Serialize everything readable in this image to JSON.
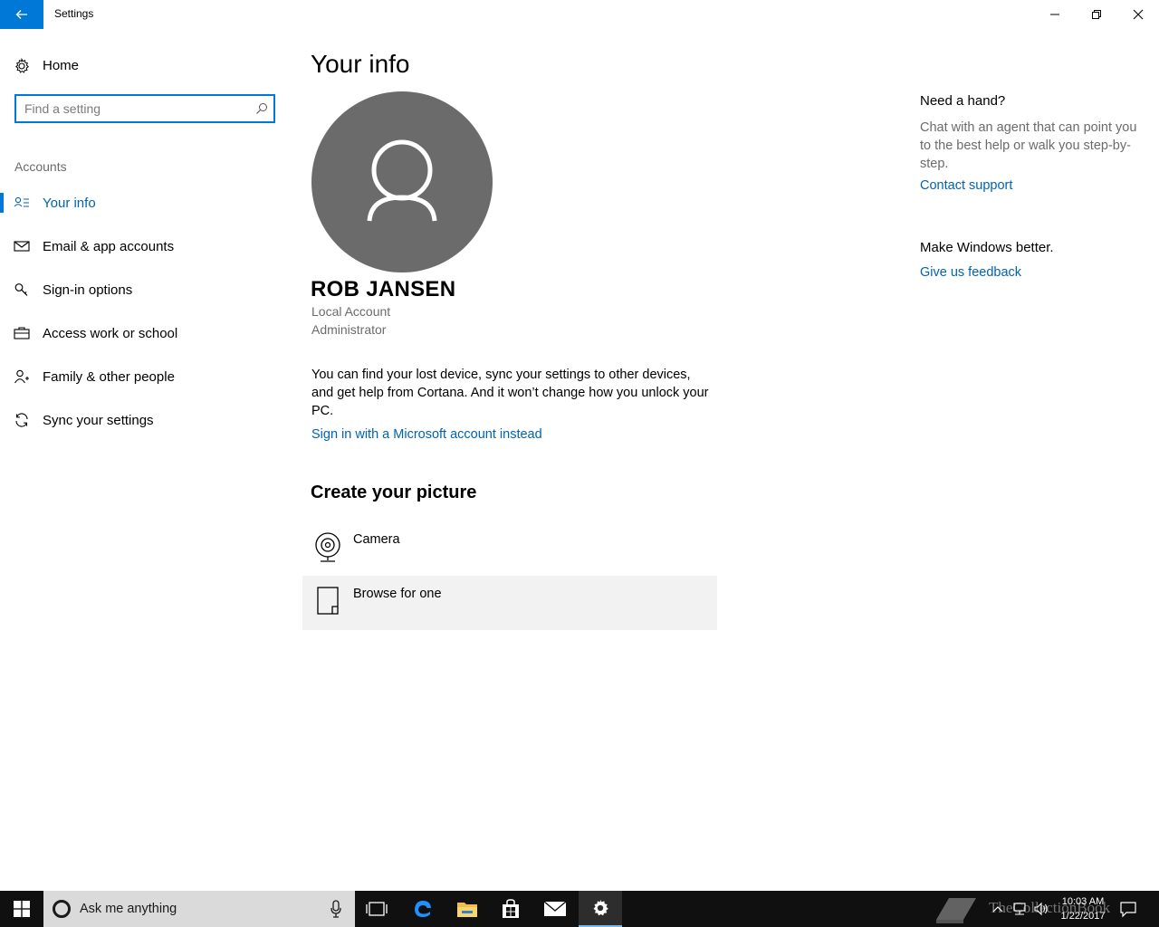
{
  "window": {
    "title": "Settings"
  },
  "sidebar": {
    "home_label": "Home",
    "search": {
      "placeholder": "Find a setting"
    },
    "section_label": "Accounts",
    "items": [
      {
        "label": "Your info",
        "icon": "your-info-icon",
        "active": true
      },
      {
        "label": "Email & app accounts",
        "icon": "mail-icon",
        "active": false
      },
      {
        "label": "Sign-in options",
        "icon": "key-icon",
        "active": false
      },
      {
        "label": "Access work or school",
        "icon": "briefcase-icon",
        "active": false
      },
      {
        "label": "Family & other people",
        "icon": "person-add-icon",
        "active": false
      },
      {
        "label": "Sync your settings",
        "icon": "sync-icon",
        "active": false
      }
    ]
  },
  "main": {
    "title": "Your info",
    "user": {
      "name": "ROB JANSEN",
      "account_type": "Local Account",
      "role": "Administrator"
    },
    "description": "You can find your lost device, sync your settings to other devices, and get help from Cortana. And it won’t change how you unlock your PC.",
    "ms_link": "Sign in with a Microsoft account instead",
    "create_title": "Create your picture",
    "picture_options": [
      {
        "label": "Camera",
        "icon": "camera-icon"
      },
      {
        "label": "Browse for one",
        "icon": "file-icon"
      }
    ]
  },
  "help": {
    "title": "Need a hand?",
    "text": "Chat with an agent that can point you to the best help or walk you step-by-step.",
    "contact_link": "Contact support",
    "better_title": "Make Windows better.",
    "feedback_link": "Give us feedback"
  },
  "taskbar": {
    "search_placeholder": "Ask me anything",
    "time": "10:03 AM",
    "date": "1/22/2017",
    "watermark": "TheCollectionBook"
  },
  "colors": {
    "accent": "#0078d7",
    "link": "#0063b1",
    "avatar": "#6b6b6b",
    "taskbar": "#101010"
  }
}
